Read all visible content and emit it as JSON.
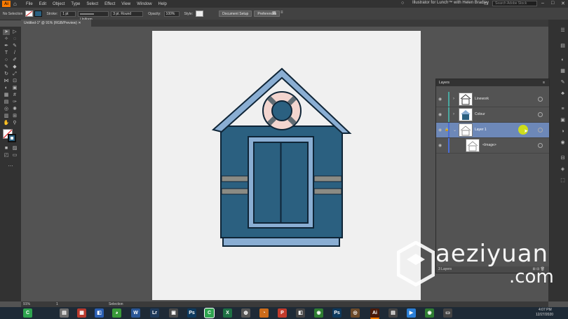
{
  "app": {
    "logo": "Ai",
    "menu": [
      "File",
      "Edit",
      "Object",
      "Type",
      "Select",
      "Effect",
      "View",
      "Window",
      "Help"
    ],
    "title": "Illustrator for Lunch™ with Helen Bradley",
    "search_placeholder": "Search Adobe Stock",
    "brand_color": "#ff7c00"
  },
  "control_bar": {
    "selection_label": "No Selection",
    "stroke_label": "Stroke:",
    "stroke_weight": "1 pt",
    "uniform_label": "Uniform",
    "brush_label": "3 pt. Round",
    "opacity_label": "Opacity:",
    "opacity_value": "100%",
    "style_label": "Style:",
    "doc_setup_label": "Document Setup",
    "preferences_label": "Preferences"
  },
  "document": {
    "tab_label": "Untitled-1* @ 91% (RGB/Preview)"
  },
  "layers_panel": {
    "title": "Layers",
    "layers": [
      {
        "name": "Linework",
        "color": "#4aa7a0",
        "visible": true
      },
      {
        "name": "Colour",
        "color": "#4aa7a0",
        "visible": true
      },
      {
        "name": "Layer 1",
        "color": "#4a6dd8",
        "visible": true,
        "selected": true,
        "locked": true
      },
      {
        "name": "<Image>",
        "color": "#4a6dd8",
        "visible": true
      }
    ],
    "footer_label": "3 Layers"
  },
  "status_bar": {
    "zoom": "91%",
    "artboard": "1",
    "mode": "Selection"
  },
  "taskbar": {
    "time": "4:07 PM",
    "date": "12/27/2020"
  },
  "watermark": {
    "line1": "aeziyuan",
    "line2": ".com"
  },
  "artwork": {
    "wall_color": "#2b6080",
    "roof_color": "#8aaed3",
    "stripe_color": "#8b8b84",
    "lifebuoy_color": "#f3d5cf",
    "outline_color": "#0f2537"
  }
}
